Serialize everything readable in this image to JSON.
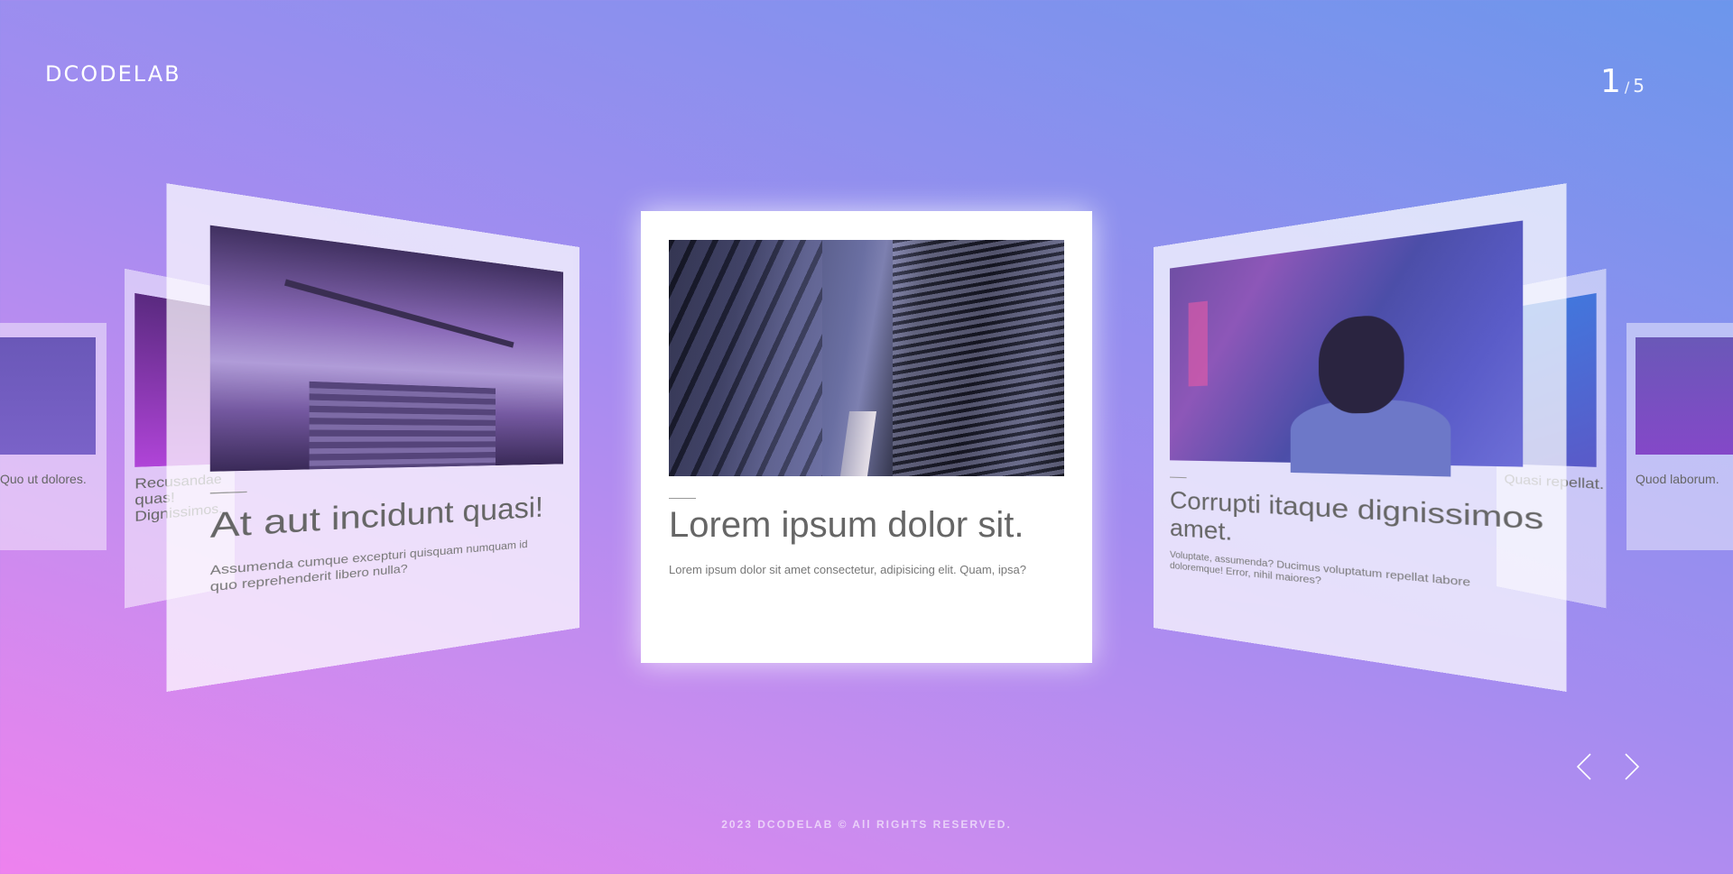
{
  "brand": {
    "logo": "DCODELAB"
  },
  "pagination": {
    "current": "1",
    "separator": "/",
    "total": "5"
  },
  "cards": {
    "center": {
      "title": "Lorem ipsum dolor sit.",
      "text": "Lorem ipsum dolor sit amet consectetur, adipisicing elit. Quam, ipsa?"
    },
    "left1": {
      "title": "At aut incidunt quasi!",
      "text": "Assumenda cumque excepturi quisquam numquam id quo reprehenderit libero nulla?"
    },
    "right1": {
      "title": "Corrupti itaque dignissimos amet.",
      "text": "Voluptate, assumenda? Ducimus voluptatum repellat labore doloremque! Error, nihil maiores?"
    },
    "left2": {
      "title": "Recusandae quas! Dignissimos."
    },
    "right2": {
      "title": "Quasi repellat."
    },
    "left3": {
      "title": "Quo ut dolores."
    },
    "right3": {
      "title": "Quod laborum."
    }
  },
  "nav": {
    "prev_icon": "chevron-left-icon",
    "next_icon": "chevron-right-icon"
  },
  "footer": {
    "copyright": "2023 DCODELAB © All RIGHTS RESERVED."
  }
}
